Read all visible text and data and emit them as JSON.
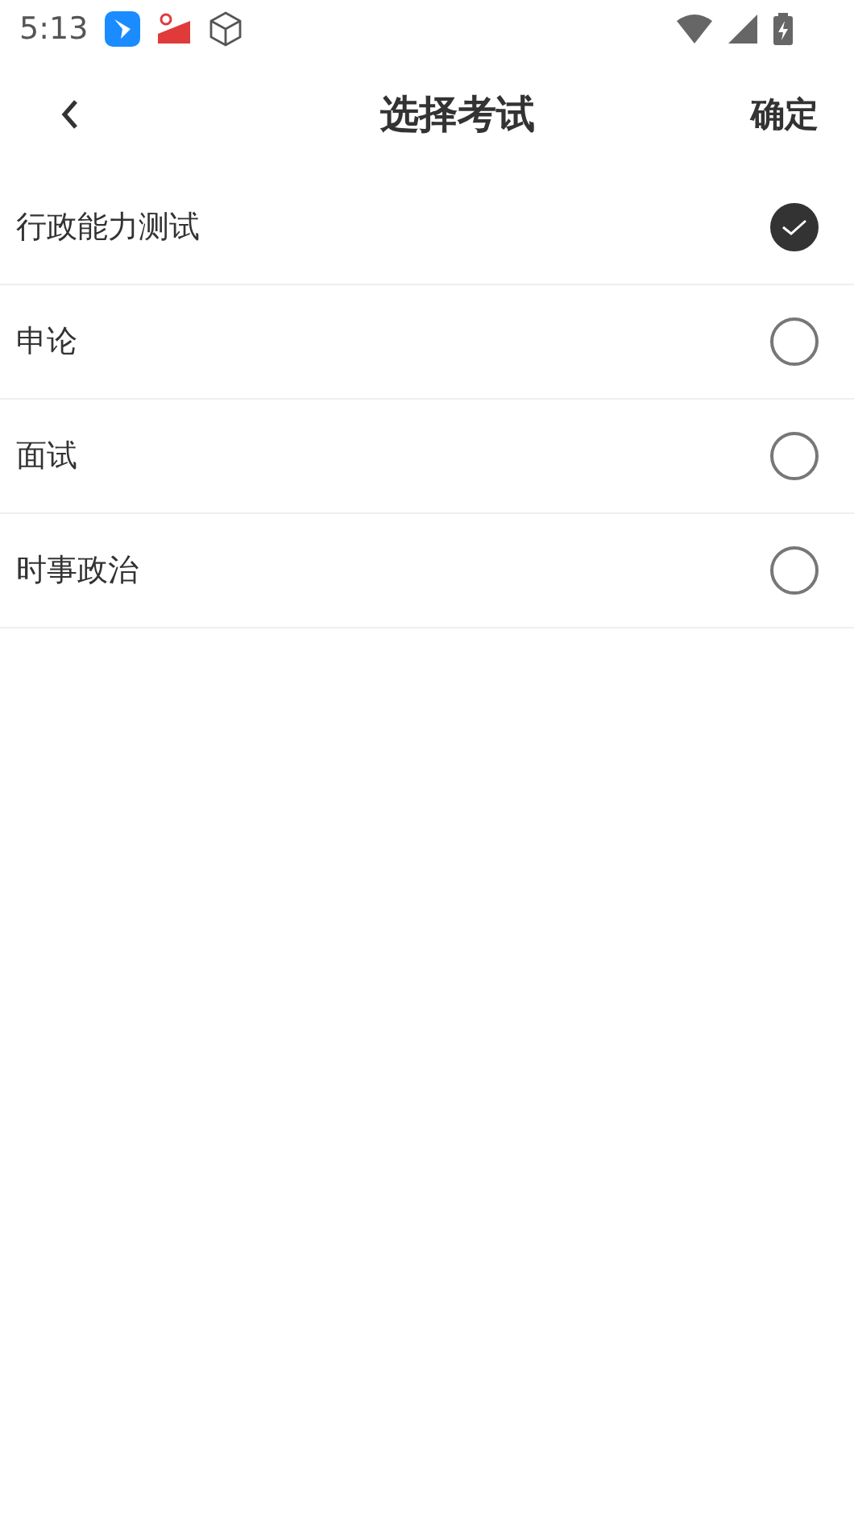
{
  "status_bar": {
    "time": "5:13"
  },
  "header": {
    "title": "选择考试",
    "confirm": "确定"
  },
  "options": [
    {
      "label": "行政能力测试",
      "selected": true
    },
    {
      "label": "申论",
      "selected": false
    },
    {
      "label": "面试",
      "selected": false
    },
    {
      "label": "时事政治",
      "selected": false
    }
  ]
}
